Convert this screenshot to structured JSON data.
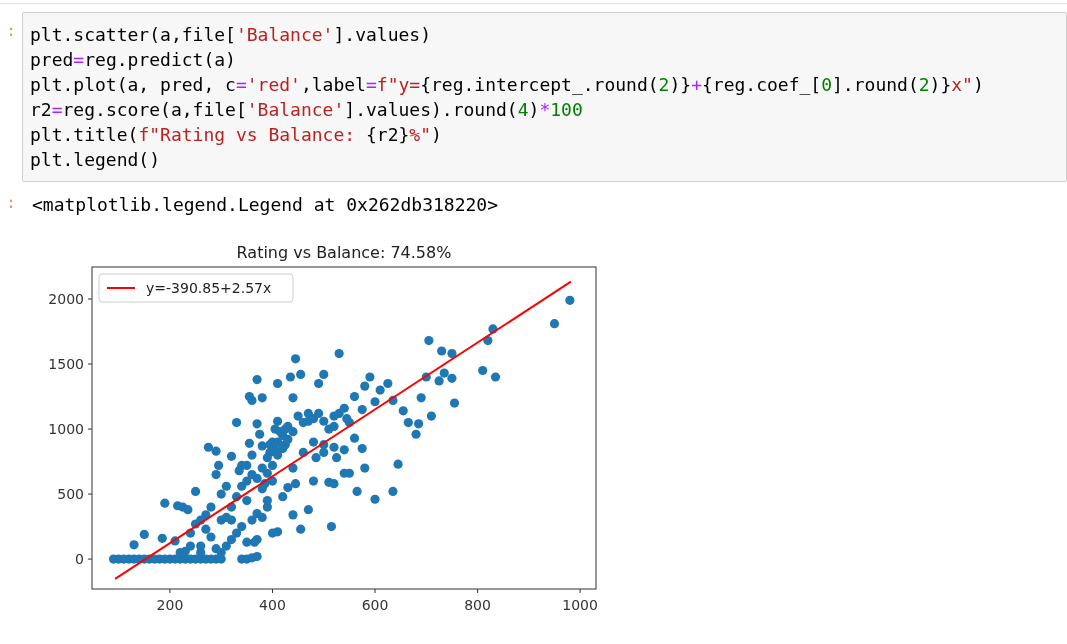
{
  "input_cell": {
    "prompt": ":",
    "lines": [
      [
        {
          "kind": "name",
          "text": "plt.scatter(a,file["
        },
        {
          "kind": "str",
          "text": "'Balance'"
        },
        {
          "kind": "name",
          "text": "].values)"
        }
      ],
      [
        {
          "kind": "name",
          "text": "pred"
        },
        {
          "kind": "op",
          "text": "="
        },
        {
          "kind": "name",
          "text": "reg.predict(a)"
        }
      ],
      [
        {
          "kind": "name",
          "text": "plt.plot(a, pred, c"
        },
        {
          "kind": "op",
          "text": "="
        },
        {
          "kind": "str",
          "text": "'red'"
        },
        {
          "kind": "name",
          "text": ",label"
        },
        {
          "kind": "op",
          "text": "="
        },
        {
          "kind": "str",
          "text": "f\"y="
        },
        {
          "kind": "name",
          "text": "{reg.intercept_.round("
        },
        {
          "kind": "num",
          "text": "2"
        },
        {
          "kind": "name",
          "text": ")}"
        },
        {
          "kind": "op",
          "text": "+"
        },
        {
          "kind": "name",
          "text": "{reg.coef_["
        },
        {
          "kind": "num",
          "text": "0"
        },
        {
          "kind": "name",
          "text": "].round("
        },
        {
          "kind": "num",
          "text": "2"
        },
        {
          "kind": "name",
          "text": ")}"
        },
        {
          "kind": "str",
          "text": "x\""
        },
        {
          "kind": "name",
          "text": ")"
        }
      ],
      [
        {
          "kind": "name",
          "text": "r2"
        },
        {
          "kind": "op",
          "text": "="
        },
        {
          "kind": "name",
          "text": "reg.score(a,file["
        },
        {
          "kind": "str",
          "text": "'Balance'"
        },
        {
          "kind": "name",
          "text": "].values).round("
        },
        {
          "kind": "num",
          "text": "4"
        },
        {
          "kind": "name",
          "text": ")"
        },
        {
          "kind": "op",
          "text": "*"
        },
        {
          "kind": "num",
          "text": "100"
        }
      ],
      [
        {
          "kind": "name",
          "text": "plt.title("
        },
        {
          "kind": "str",
          "text": "f\"Rating vs Balance: "
        },
        {
          "kind": "name",
          "text": "{r2}"
        },
        {
          "kind": "str",
          "text": "%\""
        },
        {
          "kind": "name",
          "text": ")"
        }
      ],
      [
        {
          "kind": "name",
          "text": "plt.legend()"
        }
      ]
    ]
  },
  "output": {
    "prompt": ":",
    "text": "<matplotlib.legend.Legend at 0x262db318220>",
    "chart_data": {
      "type": "scatter",
      "title": "Rating vs Balance: 74.58%",
      "xlim": [
        48,
        1031
      ],
      "ylim": [
        -230,
        2246
      ],
      "xticks": [
        {
          "value": 200,
          "label": "200"
        },
        {
          "value": 400,
          "label": "400"
        },
        {
          "value": 600,
          "label": "600"
        },
        {
          "value": 800,
          "label": "800"
        },
        {
          "value": 1000,
          "label": "1000"
        }
      ],
      "yticks": [
        {
          "value": 0,
          "label": "0"
        },
        {
          "value": 500,
          "label": "500"
        },
        {
          "value": 1000,
          "label": "1000"
        },
        {
          "value": 1500,
          "label": "1500"
        },
        {
          "value": 2000,
          "label": "2000"
        }
      ],
      "series": [
        {
          "color": "#1f77b4",
          "x": [
            90,
            100,
            110,
            120,
            130,
            140,
            150,
            160,
            170,
            180,
            190,
            200,
            210,
            220,
            230,
            240,
            250,
            260,
            270,
            280,
            290,
            300,
            340,
            350,
            360,
            370,
            130,
            150,
            185,
            190,
            215,
            225,
            210,
            235,
            250,
            240,
            250,
            260,
            270,
            280,
            275,
            290,
            295,
            290,
            300,
            310,
            320,
            330,
            335,
            340,
            355,
            355,
            360,
            370,
            370,
            380,
            375,
            380,
            385,
            390,
            395,
            400,
            405,
            410,
            410,
            420,
            425,
            430,
            435,
            440,
            445,
            455,
            450,
            460,
            470,
            480,
            490,
            500,
            510,
            520,
            530,
            540,
            550,
            560,
            575,
            580,
            590,
            600,
            610,
            625,
            635,
            655,
            665,
            685,
            680,
            690,
            700,
            705,
            710,
            725,
            730,
            735,
            750,
            750,
            755,
            810,
            820,
            830,
            835,
            950,
            980,
            420,
            430,
            440,
            445,
            440,
            455,
            470,
            480,
            485,
            500,
            510,
            520,
            515,
            525,
            540,
            550,
            560,
            565,
            575,
            580,
            600,
            635,
            645,
            400,
            410,
            360,
            370,
            380,
            390,
            350,
            340,
            330,
            320,
            310,
            300,
            290,
            280,
            260,
            270,
            300,
            310,
            320,
            330,
            340,
            350,
            360,
            370,
            380,
            390,
            400,
            410,
            420,
            380,
            390,
            400,
            410,
            430,
            350,
            360,
            370,
            320,
            240,
            230,
            220,
            260,
            350,
            365,
            395,
            405,
            415,
            425,
            440,
            460,
            480,
            500,
            520,
            470,
            490,
            530,
            545,
            500,
            520,
            540
          ],
          "values": [
            0,
            0,
            0,
            0,
            0,
            0,
            0,
            0,
            0,
            0,
            0,
            0,
            0,
            0,
            0,
            0,
            0,
            0,
            0,
            0,
            0,
            0,
            0,
            0,
            10,
            20,
            110,
            190,
            160,
            430,
            410,
            400,
            140,
            380,
            520,
            200,
            270,
            300,
            340,
            400,
            860,
            830,
            720,
            650,
            500,
            560,
            790,
            1050,
            680,
            720,
            890,
            1250,
            1220,
            1380,
            1040,
            1240,
            960,
            700,
            580,
            400,
            820,
            900,
            1000,
            1350,
            1060,
            950,
            880,
            1020,
            1400,
            1240,
            1540,
            1420,
            1100,
            820,
            1120,
            900,
            1350,
            1420,
            1000,
            1100,
            1580,
            1160,
            1050,
            1250,
            1150,
            1330,
            1400,
            1210,
            1300,
            1350,
            1220,
            1140,
            1050,
            1040,
            960,
            1240,
            1400,
            1680,
            1100,
            1370,
            1600,
            1430,
            1580,
            1390,
            1200,
            1450,
            1680,
            1770,
            1400,
            1810,
            1990,
            480,
            550,
            700,
            580,
            340,
            230,
            380,
            600,
            780,
            820,
            590,
            580,
            250,
            780,
            660,
            660,
            930,
            520,
            850,
            700,
            460,
            520,
            730,
            200,
            210,
            300,
            350,
            320,
            450,
            450,
            250,
            200,
            150,
            100,
            50,
            80,
            170,
            100,
            230,
            300,
            320,
            400,
            480,
            560,
            600,
            650,
            620,
            540,
            660,
            720,
            800,
            850,
            870,
            780,
            600,
            900,
            920,
            720,
            800,
            150,
            300,
            100,
            60,
            50,
            50,
            130,
            130,
            880,
            840,
            980,
            1000,
            980,
            1050,
            1080,
            1060,
            1020,
            1060,
            1120,
            1120,
            1080,
            880,
            860,
            840
          ]
        },
        {
          "name": "y=-390.85+2.57x",
          "type": "line",
          "color": "#ff0000",
          "x": [
            93,
            982
          ],
          "values": [
            -152,
            2133
          ]
        }
      ]
    }
  }
}
